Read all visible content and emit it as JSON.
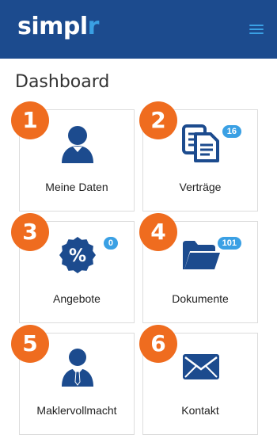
{
  "app": {
    "logo_main": "simpl",
    "logo_accent": "r"
  },
  "header": {
    "menu_icon": "hamburger-menu-icon"
  },
  "page": {
    "title": "Dashboard"
  },
  "colors": {
    "header_bg": "#1c4b8e",
    "accent": "#3aa0e4",
    "number_circle": "#ef6c1f",
    "icon": "#1c4b8e"
  },
  "tiles": [
    {
      "number": "1",
      "label": "Meine Daten",
      "icon": "user-icon",
      "badge": null
    },
    {
      "number": "2",
      "label": "Verträge",
      "icon": "documents-icon",
      "badge": "16"
    },
    {
      "number": "3",
      "label": "Angebote",
      "icon": "percent-badge-icon",
      "badge": "0"
    },
    {
      "number": "4",
      "label": "Dokumente",
      "icon": "folder-icon",
      "badge": "101"
    },
    {
      "number": "5",
      "label": "Maklervollmacht",
      "icon": "businessman-icon",
      "badge": null
    },
    {
      "number": "6",
      "label": "Kontakt",
      "icon": "envelope-icon",
      "badge": null
    }
  ]
}
